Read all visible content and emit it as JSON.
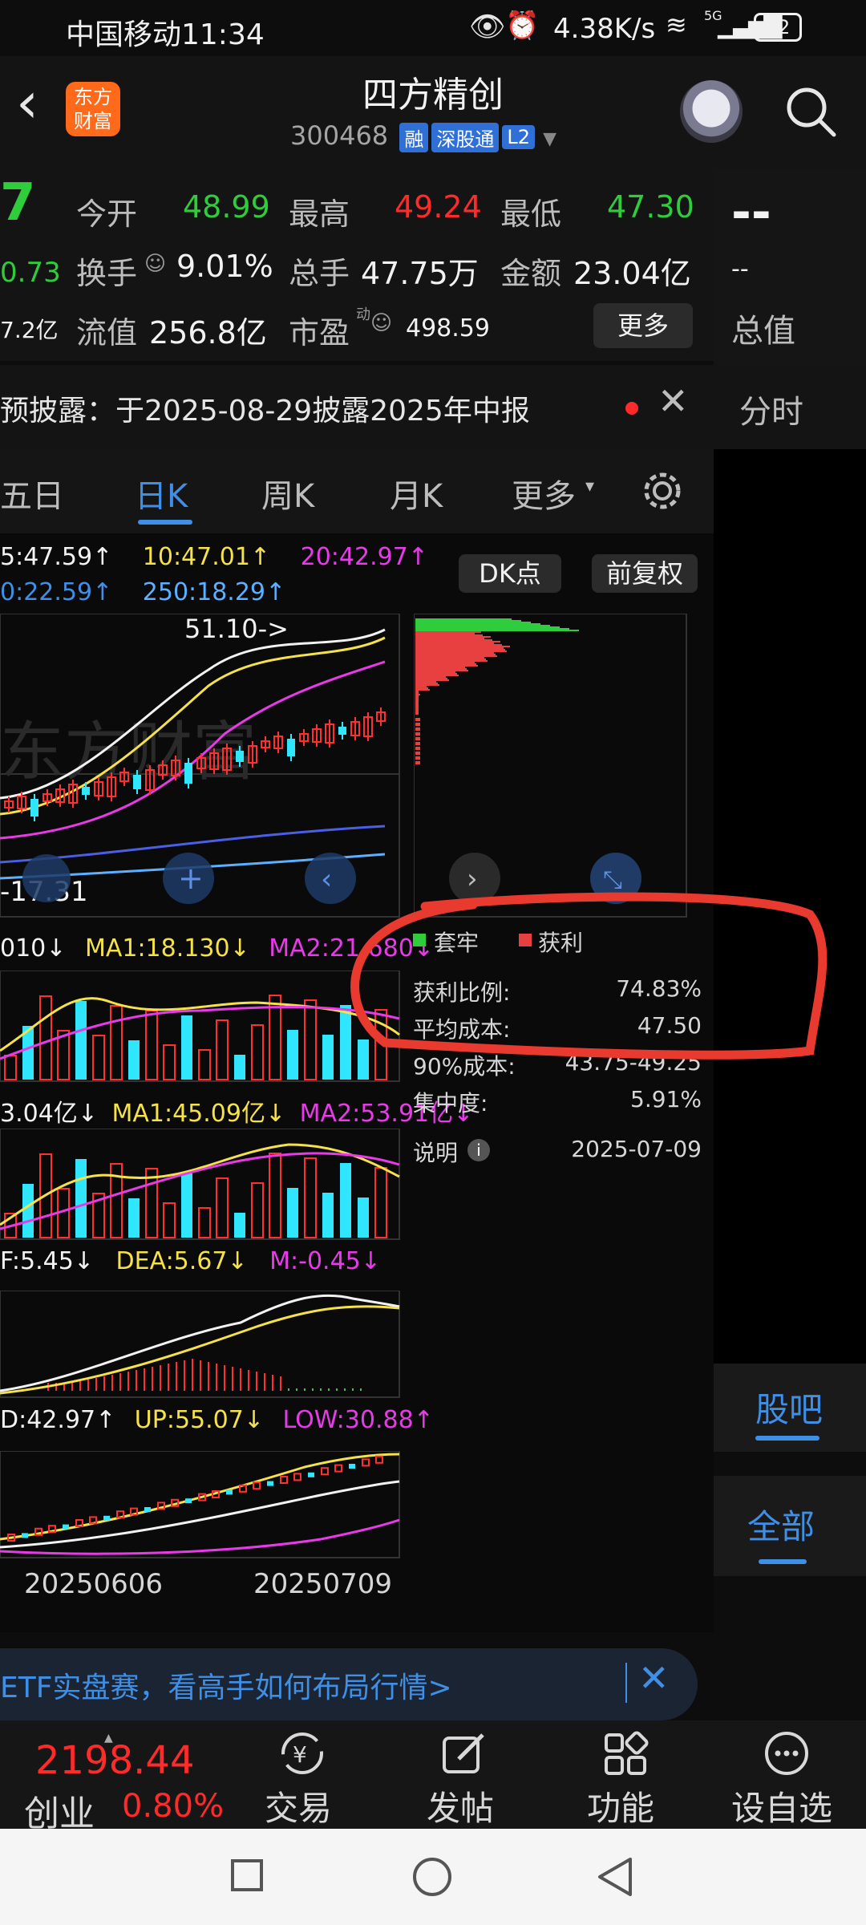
{
  "status_bar": {
    "carrier_time": "中国移动11:34",
    "speed": "4.38K/s",
    "signal": "5G",
    "battery": "32"
  },
  "header": {
    "logo_text": "东方财富",
    "title": "四方精创",
    "code": "300468",
    "tags": [
      "融",
      "深股通",
      "L2"
    ]
  },
  "quote": {
    "price_partial": "7",
    "change_partial": "0.73",
    "cap_partial": "7.2亿",
    "open_label": "今开",
    "open_value": "48.99",
    "high_label": "最高",
    "high_value": "49.24",
    "low_label": "最低",
    "low_value": "47.30",
    "turnover_label": "换手",
    "turnover_value": "9.01%",
    "volume_label": "总手",
    "volume_value": "47.75万",
    "amount_label": "金额",
    "amount_value": "23.04亿",
    "float_label": "流值",
    "float_value": "256.8亿",
    "pe_label": "市盈",
    "pe_sup": "动",
    "pe_value": "498.59",
    "more_button": "更多",
    "right_value": "--",
    "right_sub": "--",
    "total_value_label": "总值"
  },
  "notice": {
    "text": "预披露：于2025-08-29披露2025年中报"
  },
  "right_tab": "分时",
  "period_tabs": {
    "items": [
      "五日",
      "日K",
      "周K",
      "月K",
      "更多"
    ],
    "active": "日K"
  },
  "chart": {
    "ma_top": {
      "ma5": "5:47.59↑",
      "ma10": "10:47.01↑",
      "ma20": "20:42.97↑",
      "ma60": "0:22.59↑",
      "ma250": "250:18.29↑"
    },
    "dk_button": "DK点",
    "fq_button": "前复权",
    "high_label": "51.10->",
    "low_label": "-17.31",
    "watermark": "东方财富",
    "vol_legend": {
      "v": "010↓",
      "ma1": "MA1:18.130↓",
      "ma2": "MA2:21.680↓"
    },
    "amt_legend": {
      "v": "3.04亿↓",
      "ma1": "MA1:45.09亿↓",
      "ma2": "MA2:53.91亿↓"
    },
    "macd_legend": {
      "dif": "F:5.45↓",
      "dea": "DEA:5.67↓",
      "m": "M:-0.45↓"
    },
    "boll_legend": {
      "mid": "D:42.97↑",
      "up": "UP:55.07↓",
      "low": "LOW:30.88↑"
    },
    "dates": [
      "20250606",
      "20250709"
    ]
  },
  "chips_panel": {
    "legend_trap": "套牢",
    "legend_profit": "获利",
    "rows": [
      {
        "label": "获利比例:",
        "value": "74.83%"
      },
      {
        "label": "平均成本:",
        "value": "47.50"
      },
      {
        "label": "90%成本:",
        "value": "43.75-49.25"
      },
      {
        "label": "集中度:",
        "value": "5.91%"
      }
    ],
    "note_label": "说明",
    "note_date": "2025-07-09"
  },
  "side_tabs": {
    "guba": "股吧",
    "quanbu": "全部"
  },
  "banner": {
    "text": "ETF实盘赛，看高手如何布局行情>"
  },
  "bottom_nav": {
    "index_value": "2198.44",
    "index_name": "创业",
    "index_change": "0.80%",
    "items": [
      "交易",
      "发帖",
      "功能",
      "设自选"
    ]
  },
  "colors": {
    "up": "#ff2b2b",
    "down": "#2fcc3c",
    "accent": "#3f8fe6",
    "annotation": "#e83a2e"
  }
}
